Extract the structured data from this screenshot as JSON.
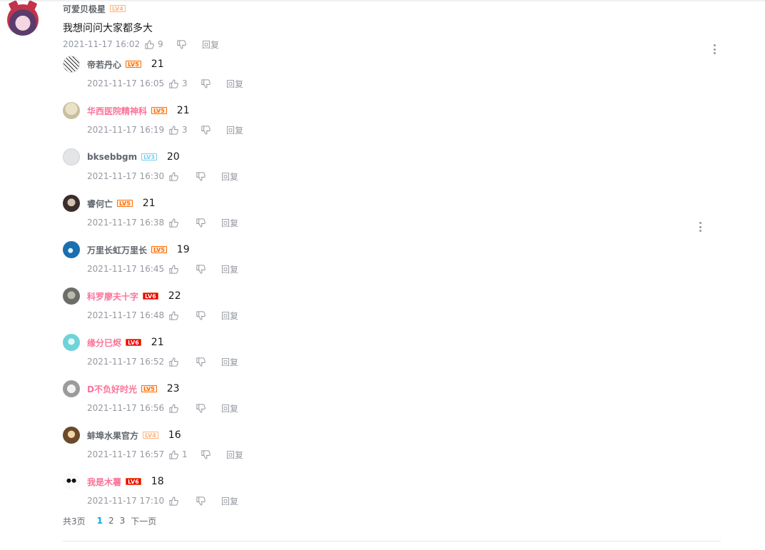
{
  "main_comment": {
    "username": "可爱贝极星",
    "level": "LV4",
    "text": "我想问问大家都多大",
    "time": "2021-11-17 16:02",
    "likes": "9",
    "reply_label": "回复"
  },
  "replies": [
    {
      "username": "帝若丹心",
      "name_color": "gray",
      "level": "LV5",
      "level_class": "lv5",
      "content": "21",
      "time": "2021-11-17 16:05",
      "likes": "3",
      "reply_label": "回复",
      "avatar": "sketch"
    },
    {
      "username": "华西医院精神科",
      "name_color": "pink",
      "level": "LV5",
      "level_class": "lv5",
      "content": "21",
      "time": "2021-11-17 16:19",
      "likes": "3",
      "reply_label": "回复",
      "avatar": "beige"
    },
    {
      "username": "bksebbgm",
      "name_color": "gray",
      "level": "LV3",
      "level_class": "lv3",
      "content": "20",
      "time": "2021-11-17 16:30",
      "likes": "",
      "reply_label": "回复",
      "avatar": "default"
    },
    {
      "username": "睿何亡",
      "name_color": "gray",
      "level": "LV5",
      "level_class": "lv5",
      "content": "21",
      "time": "2021-11-17 16:38",
      "likes": "",
      "reply_label": "回复",
      "avatar": "dark"
    },
    {
      "username": "万里长虹万里长",
      "name_color": "gray",
      "level": "LV5",
      "level_class": "lv5",
      "content": "19",
      "time": "2021-11-17 16:45",
      "likes": "",
      "reply_label": "回复",
      "avatar": "blue"
    },
    {
      "username": "科罗廖夫十字",
      "name_color": "pink",
      "level": "LV6",
      "level_class": "lv6",
      "content": "22",
      "time": "2021-11-17 16:48",
      "likes": "",
      "reply_label": "回复",
      "avatar": "grey"
    },
    {
      "username": "缘分已烬",
      "name_color": "pink",
      "level": "LV6",
      "level_class": "lv6",
      "content": "21",
      "time": "2021-11-17 16:52",
      "likes": "",
      "reply_label": "回复",
      "avatar": "cyan"
    },
    {
      "username": "D不负好时光",
      "name_color": "pink",
      "level": "LV5",
      "level_class": "lv5",
      "content": "23",
      "time": "2021-11-17 16:56",
      "likes": "",
      "reply_label": "回复",
      "avatar": "mask"
    },
    {
      "username": "蚌埠水果官方",
      "name_color": "gray",
      "level": "LV4",
      "level_class": "lv4",
      "content": "16",
      "time": "2021-11-17 16:57",
      "likes": "1",
      "reply_label": "回复",
      "avatar": "brown"
    },
    {
      "username": "我是木薯",
      "name_color": "pink",
      "level": "LV6",
      "level_class": "lv6",
      "content": "18",
      "time": "2021-11-17 17:10",
      "likes": "",
      "reply_label": "回复",
      "avatar": "panda"
    }
  ],
  "pagination": {
    "total": "共3页",
    "pages": [
      "1",
      "2",
      "3"
    ],
    "current": "1",
    "next": "下一页"
  },
  "icons": {
    "like": "thumb-up-icon",
    "dislike": "thumb-down-icon",
    "more": "more-vertical-icon"
  },
  "colors": {
    "vip_name": "#fb7299",
    "normal_name": "#61666d",
    "meta": "#9499a0",
    "pager_active": "#00aeec"
  }
}
